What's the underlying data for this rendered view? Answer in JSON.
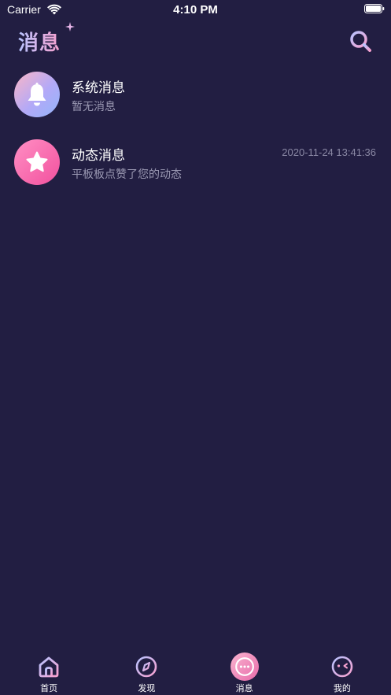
{
  "status_bar": {
    "carrier": "Carrier",
    "time": "4:10 PM"
  },
  "header": {
    "title": "消息"
  },
  "messages": [
    {
      "title": "系统消息",
      "preview": "暂无消息",
      "time": "",
      "icon": "bell-icon"
    },
    {
      "title": "动态消息",
      "preview": "平板板点赞了您的动态",
      "time": "2020-11-24 13:41:36",
      "icon": "star-icon"
    }
  ],
  "tab_bar": {
    "items": [
      {
        "label": "首页",
        "icon": "home-icon"
      },
      {
        "label": "发现",
        "icon": "compass-icon"
      },
      {
        "label": "消息",
        "icon": "chat-icon",
        "active": true
      },
      {
        "label": "我的",
        "icon": "face-icon"
      }
    ]
  },
  "colors": {
    "background": "#221e42",
    "accent_pink": "#f7a1cf",
    "accent_blue": "#b7c3ff"
  }
}
